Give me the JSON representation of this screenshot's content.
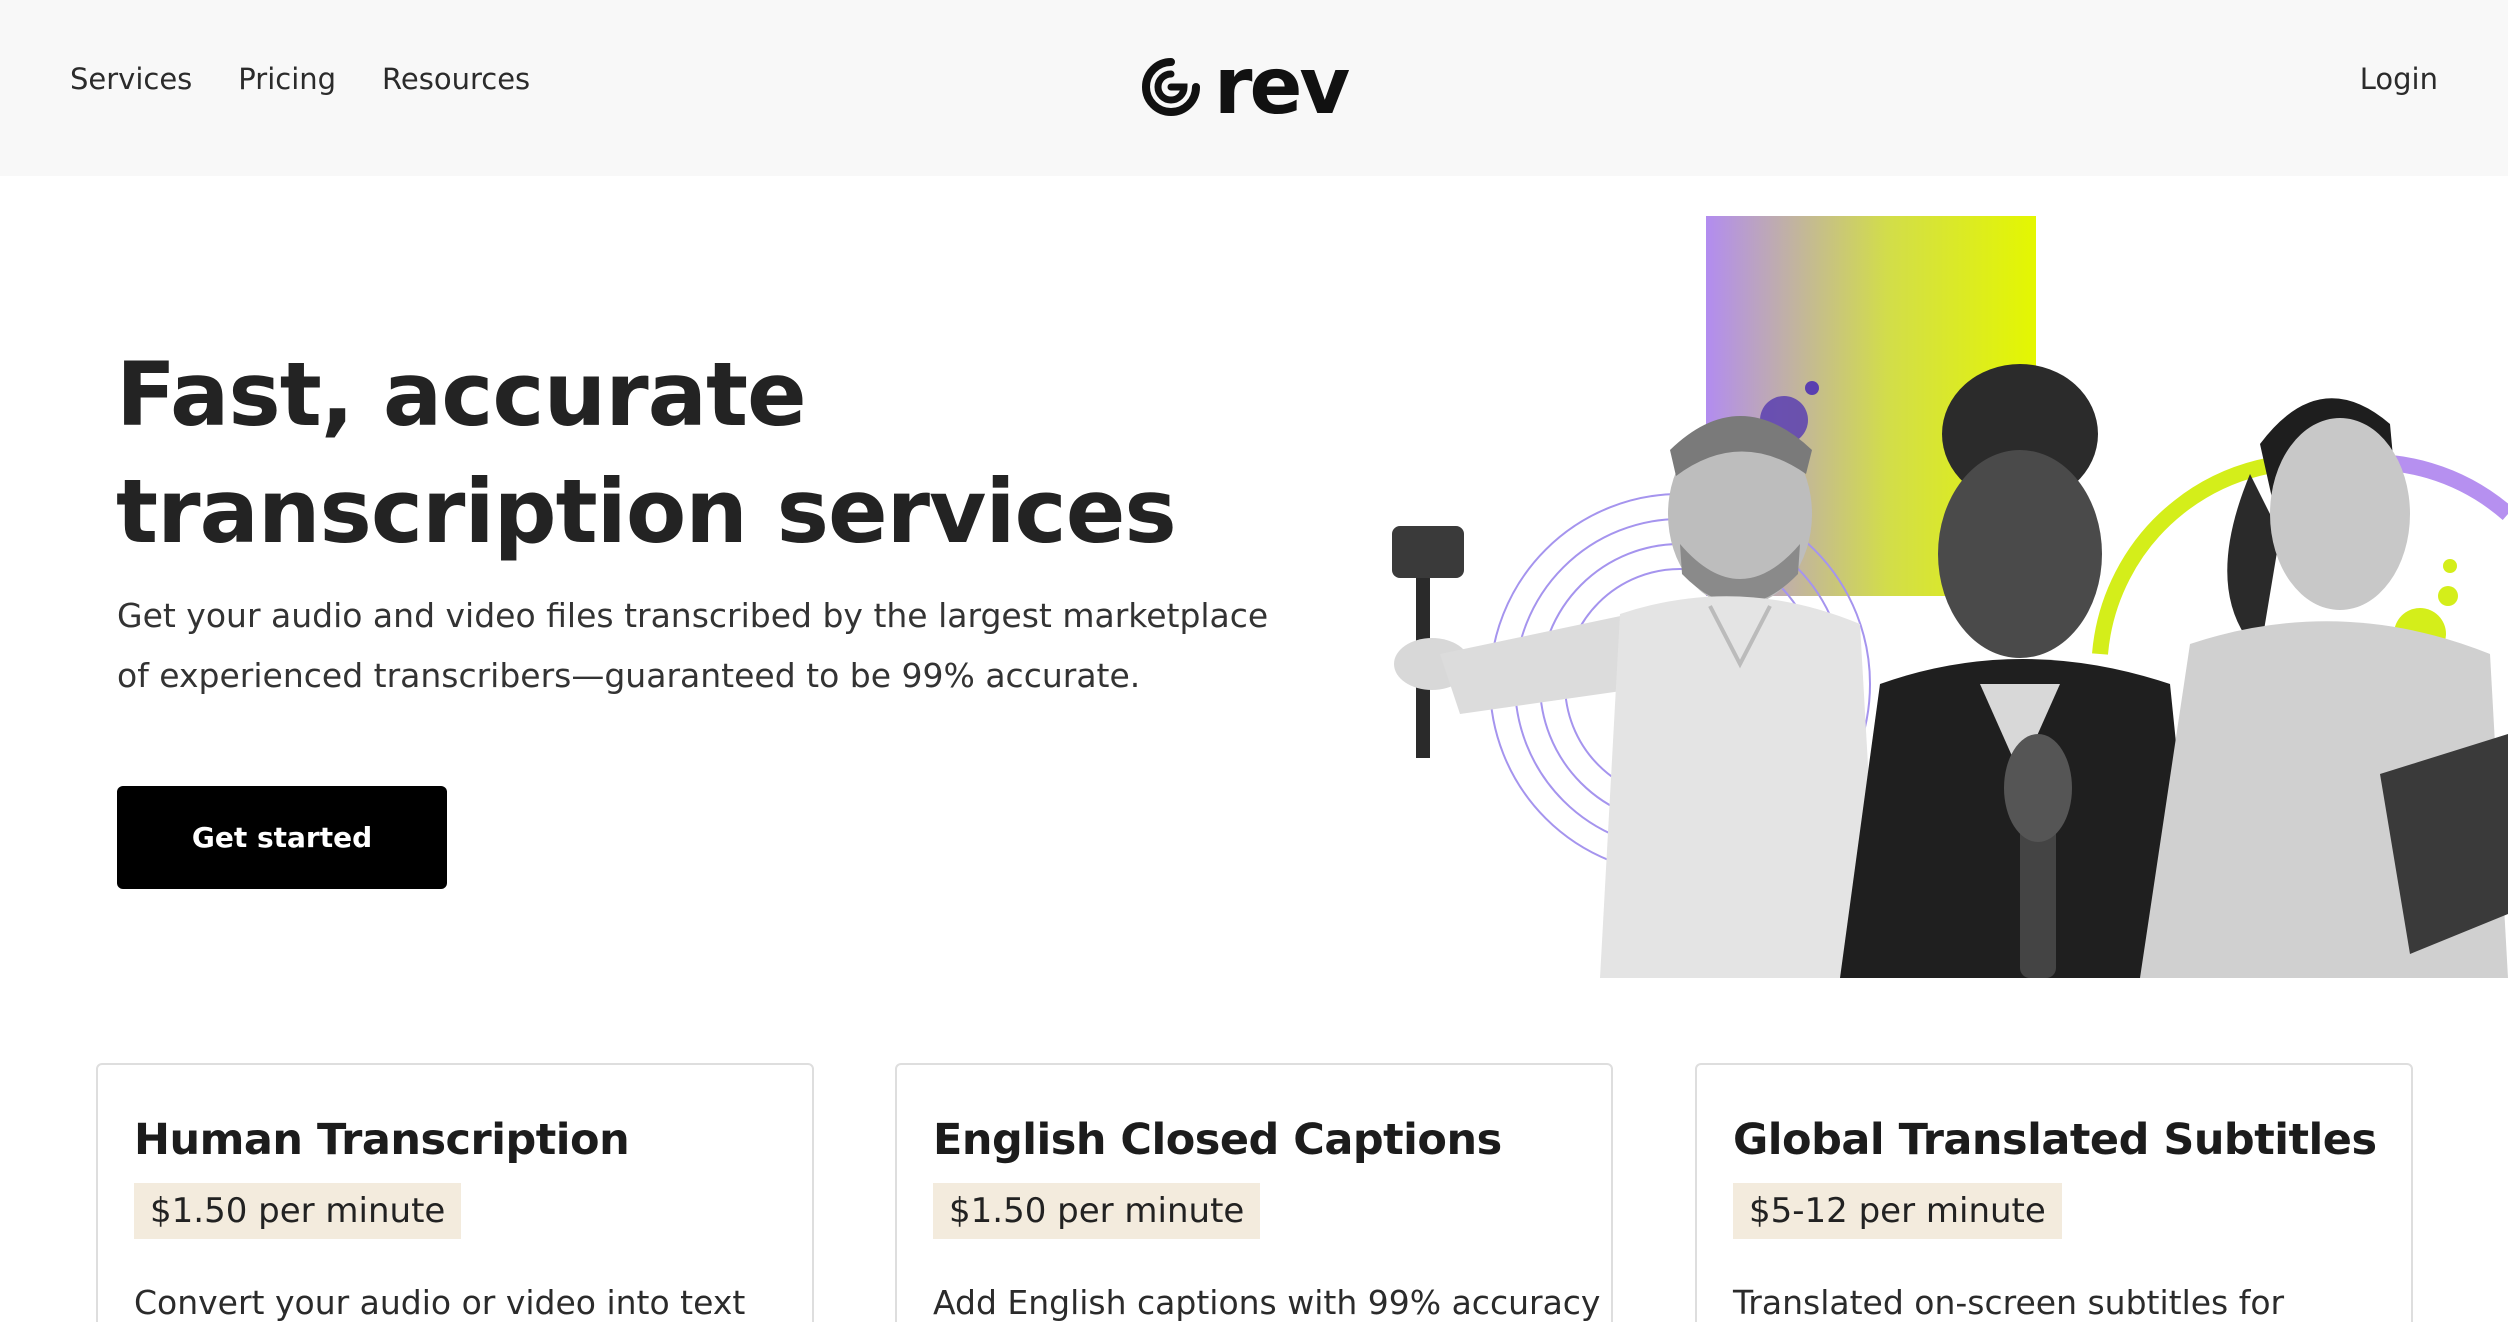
{
  "header": {
    "nav": [
      {
        "label": "Services"
      },
      {
        "label": "Pricing"
      },
      {
        "label": "Resources"
      }
    ],
    "logo_text": "rev",
    "login_label": "Login"
  },
  "hero": {
    "title_line1": "Fast, accurate",
    "title_line2": "transcription services",
    "subtitle_line1": "Get your audio and video files transcribed by the largest marketplace",
    "subtitle_line2": "of experienced transcribers—guaranteed to be 99% accurate.",
    "cta_label": "Get started"
  },
  "cards": [
    {
      "title": "Human Transcription",
      "price": "$1.50 per minute",
      "desc": "Convert your audio or video into text"
    },
    {
      "title": "English Closed Captions",
      "price": "$1.50 per minute",
      "desc": "Add English captions with 99% accuracy"
    },
    {
      "title": "Global Translated Subtitles",
      "price": "$5-12 per minute",
      "desc": "Translated on-screen subtitles for"
    }
  ],
  "colors": {
    "header_bg": "#f8f8f8",
    "cta_bg": "#000000",
    "price_tag_bg": "#f3ebdd",
    "gradient_start": "#b28cf0",
    "gradient_end": "#e4f700",
    "accent_purple": "#9b7ae6",
    "accent_lime": "#d4ee1a"
  }
}
